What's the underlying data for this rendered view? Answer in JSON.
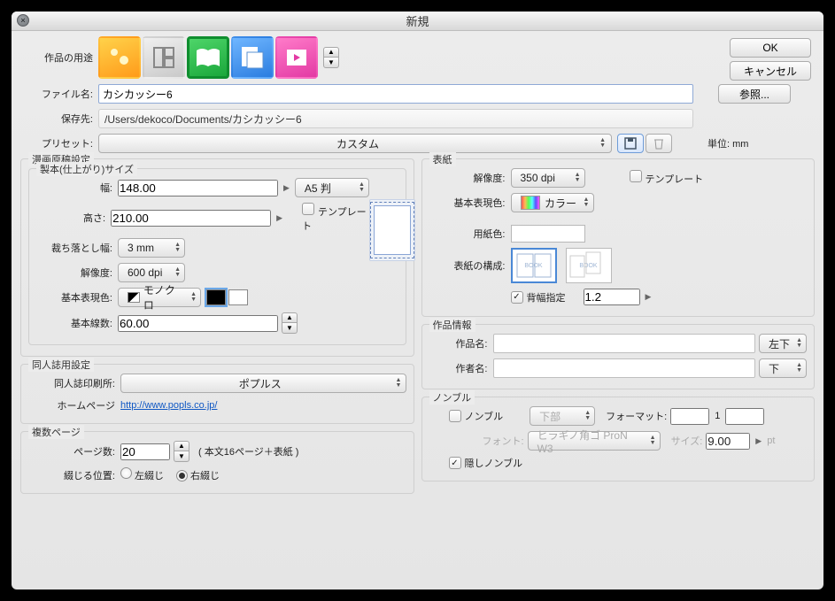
{
  "window": {
    "title": "新規"
  },
  "buttons": {
    "ok": "OK",
    "cancel": "キャンセル",
    "browse": "参照..."
  },
  "labels": {
    "purpose": "作品の用途",
    "filename": "ファイル名:",
    "saveto": "保存先:",
    "preset": "プリセット:",
    "unit_lbl": "単位:",
    "unit_val": "mm"
  },
  "filename": "カシカッシー6",
  "saveto": "/Users/dekoco/Documents/カシカッシー6",
  "preset": "カスタム",
  "manga": {
    "legend": "漫画原稿設定",
    "bind_legend": "製本(仕上がり)サイズ",
    "width_lbl": "幅:",
    "width": "148.00",
    "height_lbl": "高さ:",
    "height": "210.00",
    "size_preset": "A5 判",
    "template_lbl": "テンプレート",
    "bleed_lbl": "裁ち落とし幅:",
    "bleed": "3 mm",
    "res_lbl": "解像度:",
    "res": "600 dpi",
    "colormode_lbl": "基本表現色:",
    "colormode": "モノクロ",
    "lines_lbl": "基本線数:",
    "lines": "60.00"
  },
  "doujin": {
    "legend": "同人誌用設定",
    "printer_lbl": "同人誌印刷所:",
    "printer": "ポプルス",
    "homepage_lbl": "ホームページ",
    "homepage": "http://www.popls.co.jp/"
  },
  "multi": {
    "legend": "複数ページ",
    "pages_lbl": "ページ数:",
    "pages": "20",
    "pages_note": "( 本文16ページ＋表紙 )",
    "bind_lbl": "綴じる位置:",
    "left": "左綴じ",
    "right": "右綴じ"
  },
  "cover": {
    "legend": "表紙",
    "res_lbl": "解像度:",
    "res": "350 dpi",
    "template_lbl": "テンプレート",
    "colormode_lbl": "基本表現色:",
    "colormode": "カラー",
    "paper_lbl": "用紙色:",
    "struct_lbl": "表紙の構成:",
    "spine_lbl": "背幅指定",
    "spine": "1.2",
    "book_txt": "BOOK"
  },
  "workinfo": {
    "legend": "作品情報",
    "title_lbl": "作品名:",
    "title_pos": "左下",
    "author_lbl": "作者名:",
    "author_pos": "下"
  },
  "nombre": {
    "legend": "ノンブル",
    "nombre_lbl": "ノンブル",
    "pos": "下部",
    "format_lbl": "フォーマット:",
    "format_val": "1",
    "font_lbl": "フォント:",
    "font": "ヒラギノ角ゴ ProN W3",
    "size_lbl": "サイズ:",
    "size": "9.00",
    "pt": "pt",
    "hidden_lbl": "隠しノンブル"
  }
}
